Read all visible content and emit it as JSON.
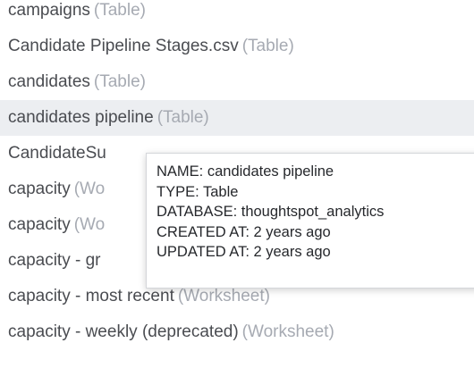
{
  "items": [
    {
      "name": "campaigns",
      "type": "(Table)"
    },
    {
      "name": "Candidate Pipeline Stages.csv",
      "type": "(Table)"
    },
    {
      "name": "candidates",
      "type": "(Table)"
    },
    {
      "name": "candidates pipeline",
      "type": "(Table)"
    },
    {
      "name": "CandidateSu",
      "type": ""
    },
    {
      "name": "capacity",
      "type": "(Wo"
    },
    {
      "name": "capacity",
      "type": "(Wo"
    },
    {
      "name": "capacity - gr",
      "type": ""
    },
    {
      "name": "capacity - most recent",
      "type": "(Worksheet)"
    },
    {
      "name": "capacity - weekly (deprecated)",
      "type": "(Worksheet)"
    }
  ],
  "tooltip": {
    "name_line": "NAME: candidates pipeline",
    "type_line": "TYPE: Table",
    "database_line": "DATABASE: thoughtspot_analytics",
    "created_line": "CREATED AT: 2 years ago",
    "updated_line": "UPDATED AT: 2 years ago"
  }
}
